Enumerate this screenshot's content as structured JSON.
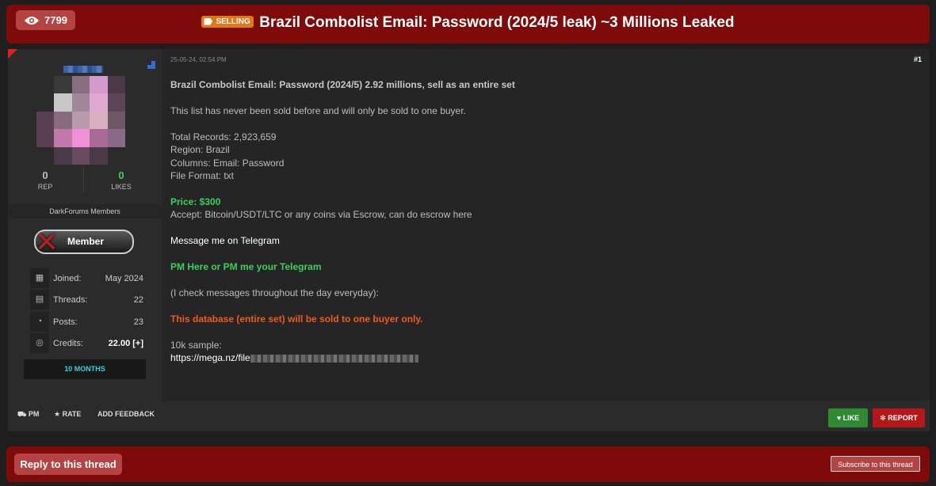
{
  "header": {
    "views_count": "7799",
    "badge_label": "SELLING",
    "title": "Brazil Combolist Email: Password (2024/5 leak) ~3 Millions Leaked"
  },
  "sidebar": {
    "rep_value": "0",
    "rep_label": "REP",
    "likes_value": "0",
    "likes_label": "LIKES",
    "group_name": "DarkForums Members",
    "member_badge": "Member",
    "joined_label": "Joined:",
    "joined_value": "May 2024",
    "threads_label": "Threads:",
    "threads_value": "22",
    "posts_label": "Posts:",
    "posts_value": "23",
    "credits_label": "Credits:",
    "credits_value": "22.00 [+]",
    "membership_duration": "10 MONTHS"
  },
  "post": {
    "date": "25-05-24, 02:54 PM",
    "number": "#1",
    "heading": "Brazil Combolist Email: Password (2024/5) 2.92 millions, sell as an entire set",
    "line_never_sold": "This list has never been sold before and will only be sold to one buyer.",
    "total_records": "Total Records: 2,923,659",
    "region": "Region: Brazil",
    "columns": "Columns: Email: Password",
    "file_format": "File Format: txt",
    "price": "Price: $300",
    "accept": "Accept: Bitcoin/USDT/LTC or any coins via Escrow, can do escrow here",
    "message_telegram": "Message me on Telegram",
    "pm_here": "PM Here or PM me your Telegram",
    "check_messages": "(I check messages throughout the day everyday):",
    "warning": "This database (entire set) will be sold to one buyer only.",
    "sample_label": "10k sample:",
    "sample_link_prefix": "https://mega.nz/file"
  },
  "footer": {
    "pm_label": "PM",
    "rate_label": "RATE",
    "feedback_label": "ADD FEEDBACK",
    "like_label": "LIKE",
    "report_label": "REPORT"
  },
  "bottom": {
    "reply_label": "Reply to this thread",
    "subscribe_label": "Subscribe to this thread"
  },
  "colors": {
    "header_bg": "#7f0a0a",
    "badge": "#e07818",
    "price_green": "#3cd05a",
    "warning_orange": "#f05a1a",
    "like_green": "#2f8a32",
    "report_red": "#b41818"
  },
  "icons": [
    "eye-icon",
    "tag-icon",
    "calendar-icon",
    "book-icon",
    "comments-icon",
    "coins-icon",
    "heart-icon",
    "star-icon",
    "bug-icon"
  ]
}
